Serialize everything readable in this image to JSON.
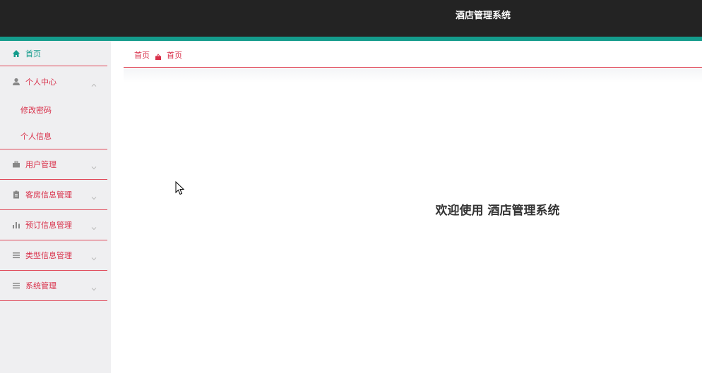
{
  "header": {
    "title": "酒店管理系统"
  },
  "sidebar": {
    "home": {
      "label": "首页",
      "icon": "home-icon"
    },
    "groups": [
      {
        "label": "个人中心",
        "icon": "user-icon",
        "expanded": true,
        "children": [
          {
            "label": "修改密码"
          },
          {
            "label": "个人信息"
          }
        ]
      },
      {
        "label": "用户管理",
        "icon": "briefcase-icon",
        "expanded": false
      },
      {
        "label": "客房信息管理",
        "icon": "clipboard-icon",
        "expanded": false
      },
      {
        "label": "预订信息管理",
        "icon": "bar-chart-icon",
        "expanded": false
      },
      {
        "label": "类型信息管理",
        "icon": "list-icon",
        "expanded": false
      },
      {
        "label": "系统管理",
        "icon": "list-icon",
        "expanded": false
      }
    ]
  },
  "breadcrumb": {
    "home": "首页",
    "separator_icon": "basket-icon",
    "current": "首页"
  },
  "main": {
    "welcome": "欢迎使用 酒店管理系统"
  },
  "colors": {
    "header_bg": "#232323",
    "accent_teal": "#149c8c",
    "accent_red": "#d9304a",
    "sidebar_bg": "#efeff1"
  }
}
